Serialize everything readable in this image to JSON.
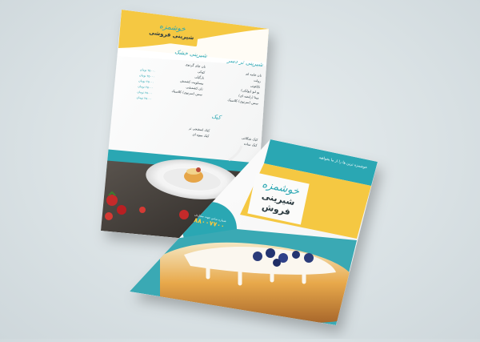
{
  "menu_flyer": {
    "brand_script": "خوشمزه",
    "brand_name": "شیرینی فروشی",
    "section_1_title": "شیرینی تر دسر",
    "section_2_title": "شیرینی خشک",
    "section_3_title": "کیک",
    "right_items": [
      "نان خامه ای",
      "رولت",
      "ناپلئونی",
      "یو لبو (پولکی)",
      "مینا (رایضه ای)",
      "سس (سرنوی) کلاسیک"
    ],
    "left_items": [
      "نان چای گردوی",
      "کوکی",
      "نارگیلی",
      "بیسکویت کشمش",
      "نان کشمشی",
      "سس (سرنوی) کلاسیک"
    ],
    "cake_items_right": [
      "کیک شکلاتی",
      "کیک ساده"
    ],
    "cake_items_left": [
      "کیک اسفنجی تر",
      "کیک میوه ای"
    ],
    "price_text": "۲۵۰۰۰ تومان"
  },
  "cover_flyer": {
    "tagline": "خوشمزه ترین ها را از ما بخواهید",
    "brand_script": "خوشمزه",
    "brand_name": "شیرینی فروش",
    "phone": "۸۸۰۰۷۷۰۰",
    "phone_label": "شماره تماس جهت سفارش"
  },
  "colors": {
    "accent_yellow": "#f5c842",
    "accent_teal": "#2aa7b3",
    "paper": "#fbfbfa"
  }
}
